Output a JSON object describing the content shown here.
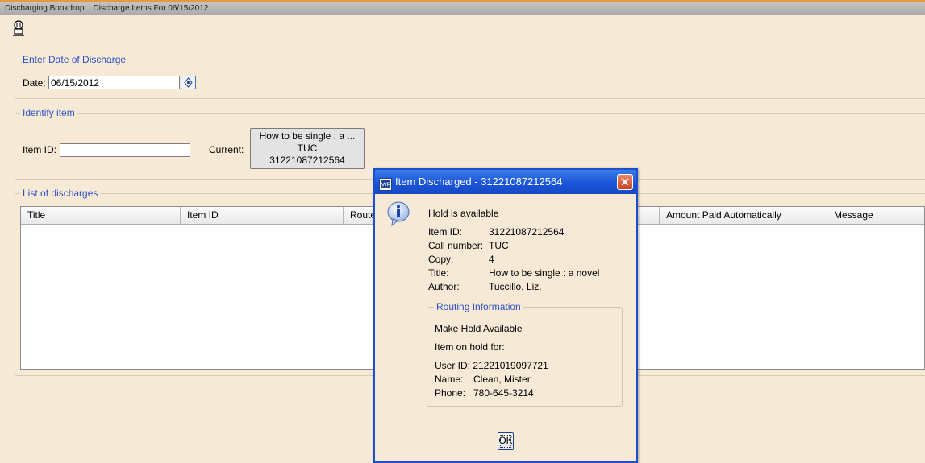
{
  "window": {
    "title": "Discharging Bookdrop: : Discharge Items For 06/15/2012"
  },
  "toolbar": {
    "icon": "helper-tool-icon"
  },
  "date_section": {
    "legend": "Enter Date of Discharge",
    "date_label": "Date:",
    "date_value": "06/15/2012",
    "calendar_icon": "calendar-icon"
  },
  "identify_section": {
    "legend": "Identify item",
    "item_id_label": "Item ID:",
    "item_id_value": "",
    "current_label": "Current:",
    "current_lines": [
      "How to be single : a ...",
      "TUC",
      "31221087212564"
    ]
  },
  "discharges": {
    "legend": "List of discharges",
    "columns": [
      "Title",
      "Item ID",
      "Route",
      "Amount Paid Automatically",
      "Message"
    ],
    "rows": []
  },
  "dialog": {
    "title": "Item Discharged - 31221087212564",
    "close_label": "✕",
    "heading": "Hold is available",
    "fields": [
      {
        "label": "Item ID:",
        "value": "31221087212564"
      },
      {
        "label": "Call number:",
        "value": "TUC"
      },
      {
        "label": "Copy:",
        "value": "4"
      },
      {
        "label": "Title:",
        "value": "How to be single : a novel"
      },
      {
        "label": "Author:",
        "value": "Tuccillo, Liz."
      }
    ],
    "routing": {
      "legend": "Routing Information",
      "action": "Make Hold Available",
      "hold_for": "Item on hold for:",
      "user_id": "User ID: 21221019097721",
      "name_label": "Name:",
      "name_value": "Clean, Mister",
      "phone_label": "Phone:",
      "phone_value": "780-645-3214"
    },
    "ok_label": "OK"
  },
  "colors": {
    "accent": "#2b4fc4",
    "dialog_title": "#1a55d8",
    "background": "#f6e9d6"
  }
}
